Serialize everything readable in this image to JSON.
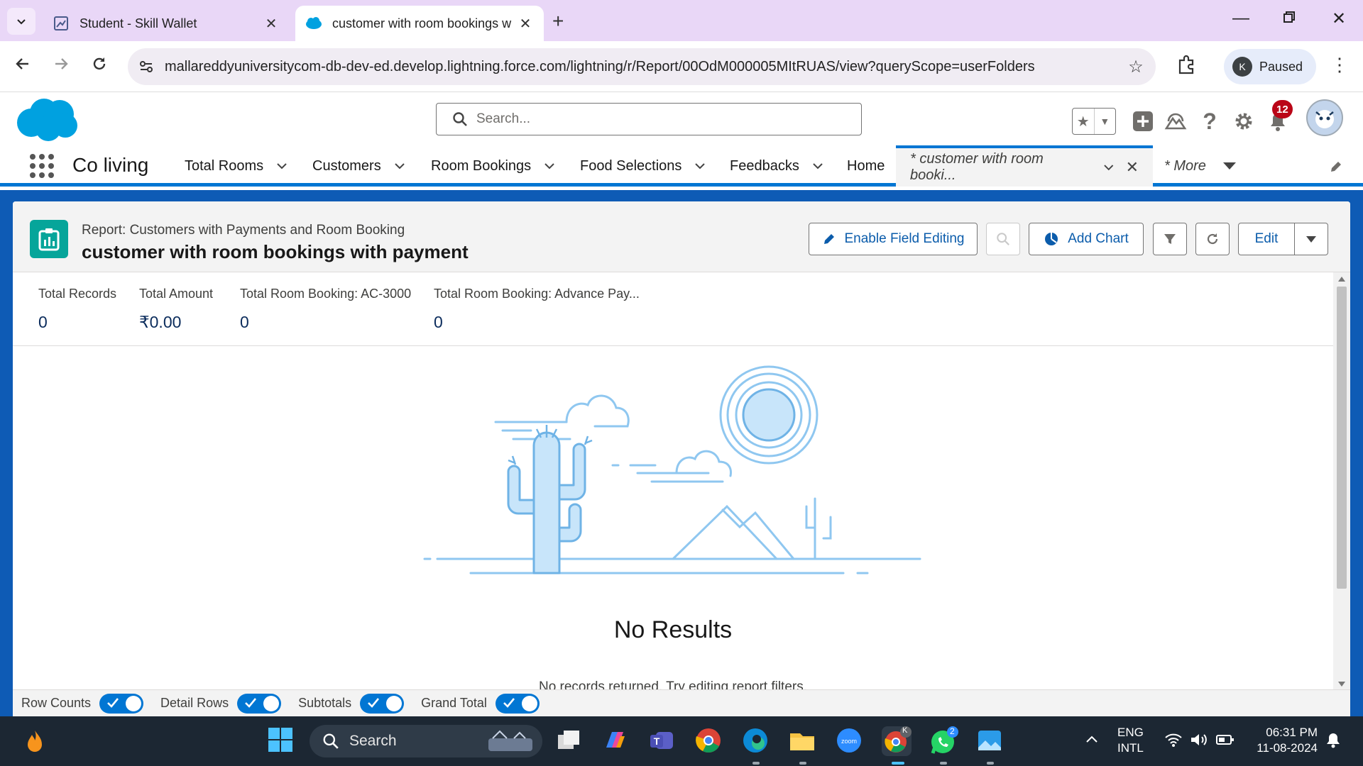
{
  "browser": {
    "tabs": [
      {
        "title": "Student - Skill Wallet",
        "active": false
      },
      {
        "title": "customer with room bookings w",
        "active": true
      }
    ],
    "url": "mallareddyuniversitycom-db-dev-ed.develop.lightning.force.com/lightning/r/Report/00OdM000005MItRUAS/view?queryScope=userFolders",
    "profile_initial": "K",
    "profile_status": "Paused"
  },
  "sf_header": {
    "search_placeholder": "Search...",
    "notification_count": "12"
  },
  "app_nav": {
    "app_name": "Co living",
    "items": [
      {
        "label": "Total Rooms"
      },
      {
        "label": "Customers"
      },
      {
        "label": "Room Bookings"
      },
      {
        "label": "Food Selections"
      },
      {
        "label": "Feedbacks"
      },
      {
        "label": "Home"
      }
    ],
    "active_tab": "* customer with room booki...",
    "more_label": "* More"
  },
  "report": {
    "type_label": "Report: Customers with Payments and Room Booking",
    "title": "customer with room bookings with payment",
    "buttons": {
      "enable_field_editing": "Enable Field Editing",
      "add_chart": "Add Chart",
      "edit": "Edit"
    },
    "metrics": [
      {
        "label": "Total Records",
        "value": "0"
      },
      {
        "label": "Total Amount",
        "value": "₹0.00"
      },
      {
        "label": "Total Room Booking: AC-3000",
        "value": "0"
      },
      {
        "label": "Total Room Booking: Advance Pay...",
        "value": "0"
      }
    ],
    "empty_title": "No Results",
    "empty_hint": "No records returned. Try editing report filters."
  },
  "footer_toggles": [
    {
      "label": "Row Counts",
      "on": true
    },
    {
      "label": "Detail Rows",
      "on": true
    },
    {
      "label": "Subtotals",
      "on": true
    },
    {
      "label": "Grand Total",
      "on": true
    }
  ],
  "taskbar": {
    "search_label": "Search",
    "whatsapp_badge": "2",
    "chrome_badge": "K",
    "lang_line1": "ENG",
    "lang_line2": "INTL",
    "time": "06:31 PM",
    "date": "11-08-2024"
  },
  "colors": {
    "brand_blue": "#0176d3",
    "canvas_blue": "#0e5bb5",
    "report_icon": "#06a59a",
    "tab_strip": "#e9d7f7"
  }
}
